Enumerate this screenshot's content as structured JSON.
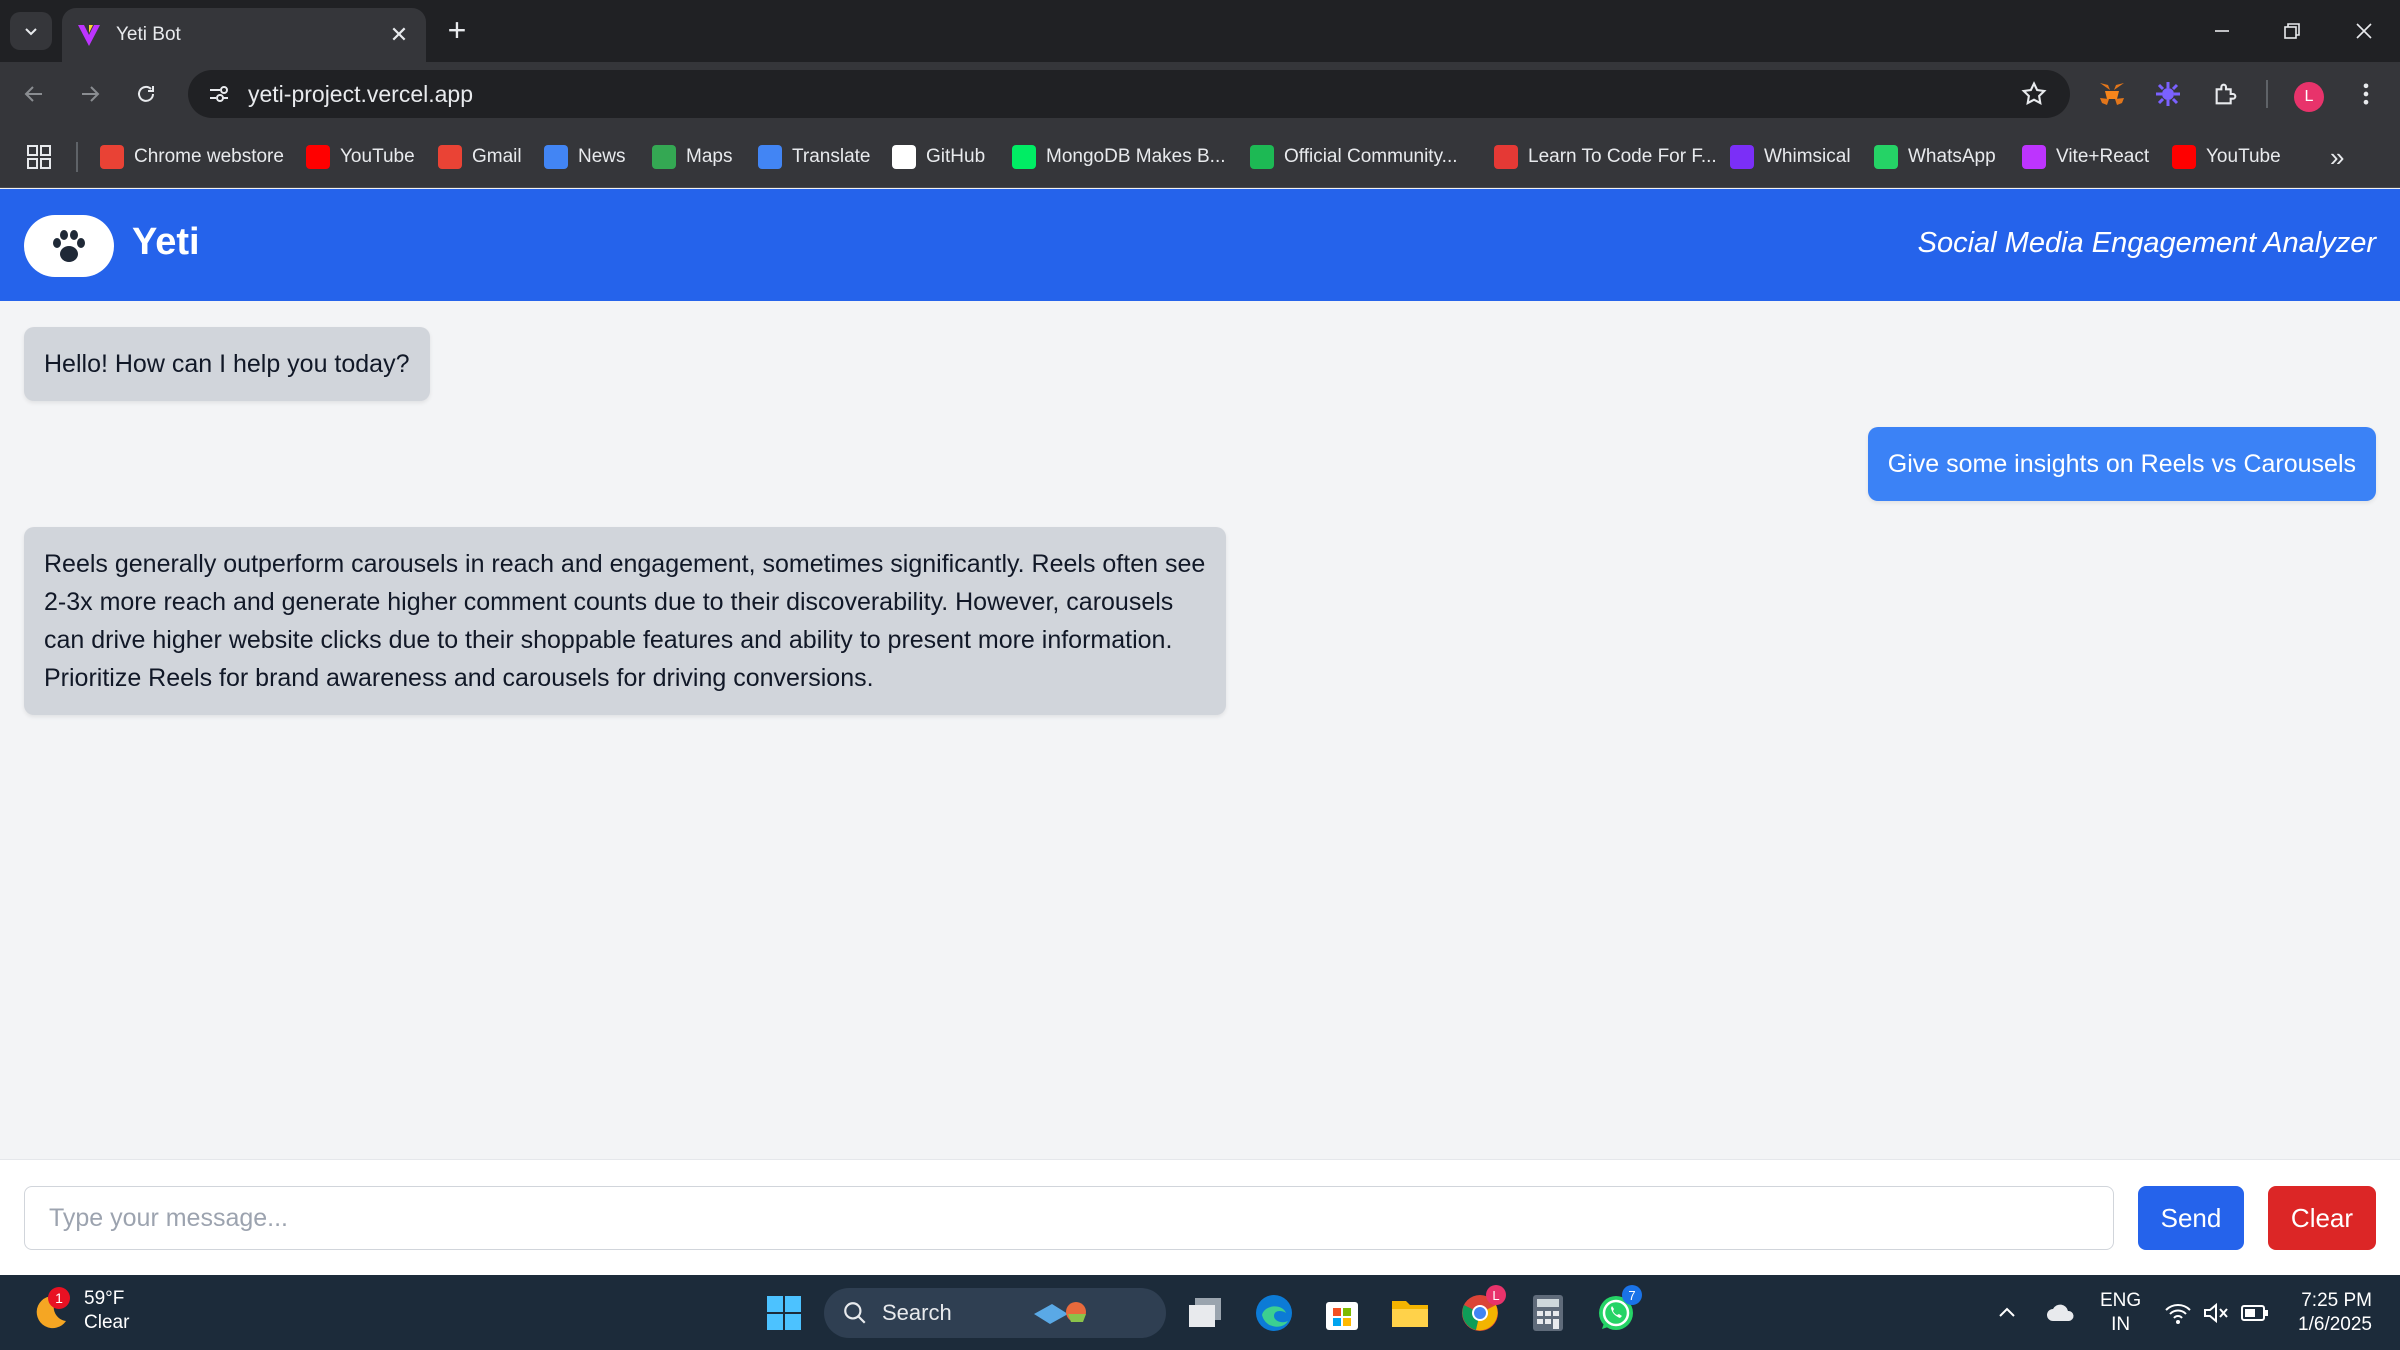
{
  "browser": {
    "tab_title": "Yeti Bot",
    "url": "yeti-project.vercel.app",
    "profile_initial": "L",
    "bookmarks": [
      {
        "label": "Chrome webstore",
        "icon": "chrome-webstore-icon",
        "color": "#e94235"
      },
      {
        "label": "YouTube",
        "icon": "youtube-icon",
        "color": "#ff0000"
      },
      {
        "label": "Gmail",
        "icon": "gmail-icon",
        "color": "#ea4335"
      },
      {
        "label": "News",
        "icon": "google-news-icon",
        "color": "#4285f4"
      },
      {
        "label": "Maps",
        "icon": "google-maps-icon",
        "color": "#34a853"
      },
      {
        "label": "Translate",
        "icon": "google-translate-icon",
        "color": "#4285f4"
      },
      {
        "label": "GitHub",
        "icon": "github-icon",
        "color": "#ffffff"
      },
      {
        "label": "MongoDB Makes B...",
        "icon": "mongodb-icon",
        "color": "#00ed64"
      },
      {
        "label": "Official Community...",
        "icon": "community-icon",
        "color": "#1db954"
      },
      {
        "label": "Learn To Code For F...",
        "icon": "learn-code-icon",
        "color": "#e53935"
      },
      {
        "label": "Whimsical",
        "icon": "whimsical-icon",
        "color": "#7b2ff7"
      },
      {
        "label": "WhatsApp",
        "icon": "whatsapp-icon",
        "color": "#25d366"
      },
      {
        "label": "Vite+React",
        "icon": "vite-icon",
        "color": "#bd34fe"
      },
      {
        "label": "YouTube",
        "icon": "youtube-icon",
        "color": "#ff0000"
      }
    ]
  },
  "app": {
    "brand": "Yeti",
    "subtitle": "Social Media Engagement Analyzer",
    "accent_color": "#2563eb",
    "messages": [
      {
        "role": "bot",
        "text": "Hello! How can I help you today?"
      },
      {
        "role": "user",
        "text": "Give some insights on Reels vs Carousels"
      },
      {
        "role": "bot",
        "text": "Reels generally outperform carousels in reach and engagement, sometimes significantly. Reels often see 2-3x more reach and generate higher comment counts due to their discoverability. However, carousels can drive higher website clicks due to their shoppable features and ability to present more information. Prioritize Reels for brand awareness and carousels for driving conversions."
      }
    ],
    "input_placeholder": "Type your message...",
    "send_label": "Send",
    "clear_label": "Clear"
  },
  "taskbar": {
    "weather_temp": "59°F",
    "weather_desc": "Clear",
    "weather_badge": "1",
    "search_label": "Search",
    "chrome_badge": "L",
    "whatsapp_badge": "7",
    "lang_line1": "ENG",
    "lang_line2": "IN",
    "time": "7:25 PM",
    "date": "1/6/2025"
  }
}
